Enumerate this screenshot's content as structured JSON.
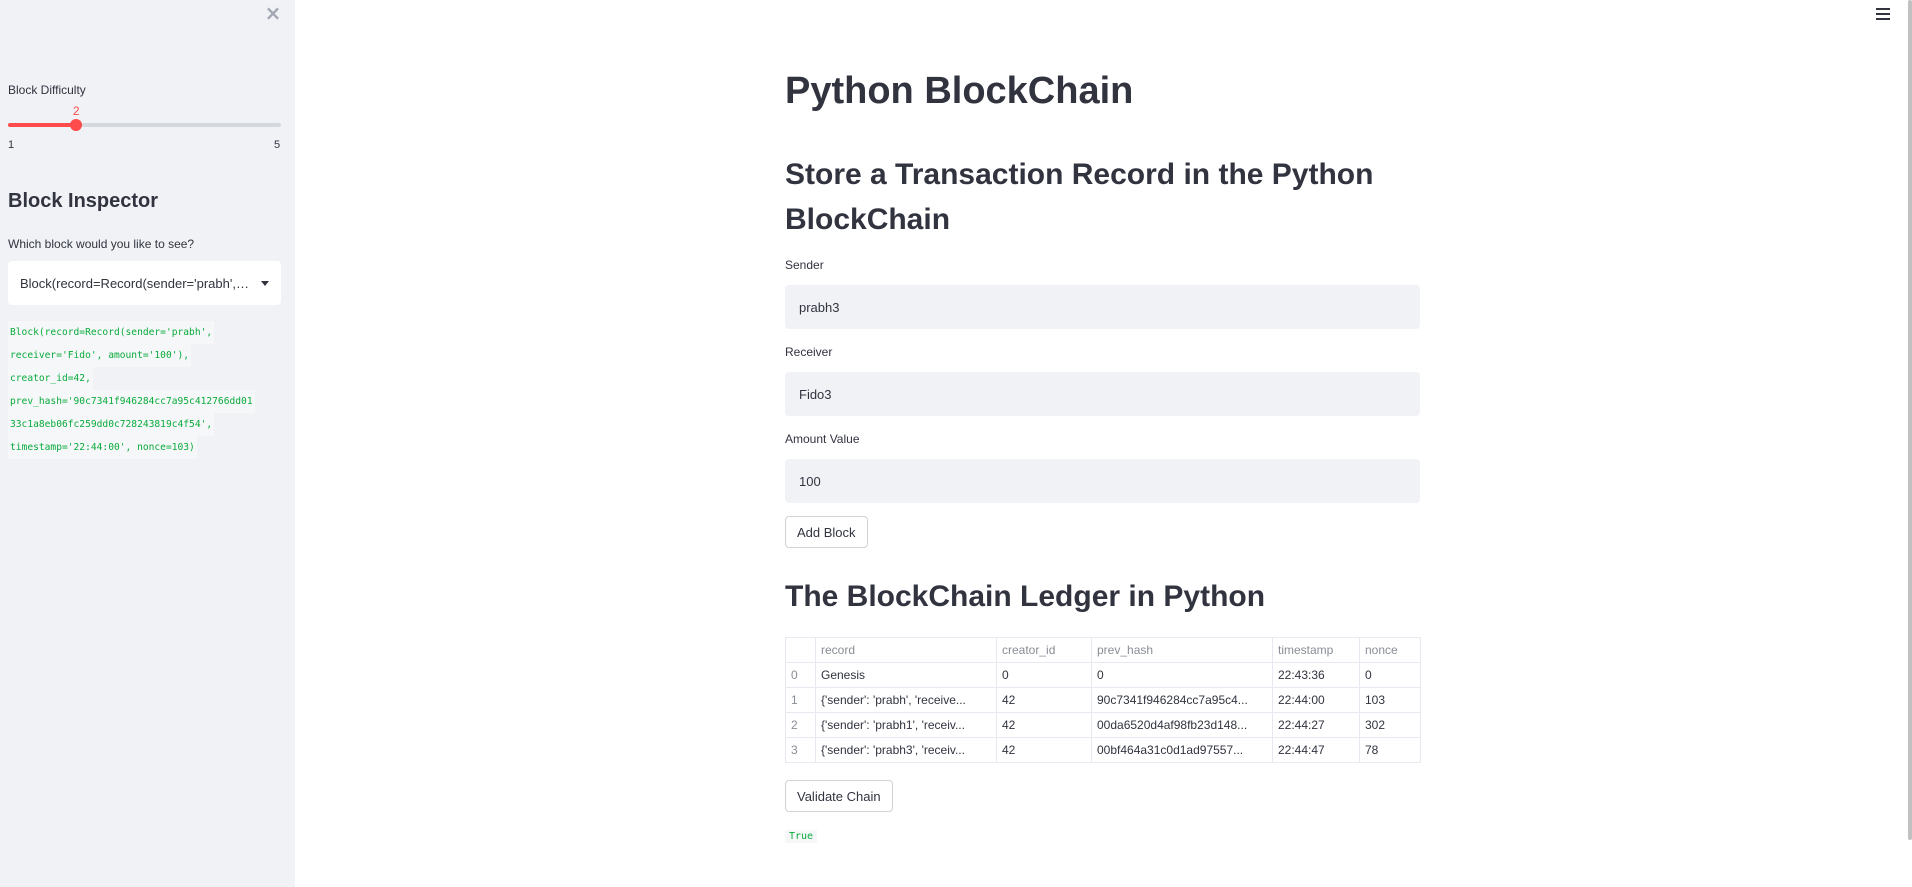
{
  "sidebar": {
    "close_glyph": "×",
    "difficulty": {
      "label": "Block Difficulty",
      "value": 2,
      "min": 1,
      "max": 5,
      "min_label": "1",
      "max_label": "5",
      "value_label": "2"
    },
    "inspector": {
      "heading": "Block Inspector",
      "question": "Which block would you like to see?",
      "selected": "Block(record=Record(sender='prabh', receiver='Fido', amount='100'), creator_id=42, prev_hash='90c7341f946284cc7a95c412766dd0133c1a8eb06fc259dd0c728243819c4f54', timestamp='22:44:00', nonce=103)",
      "code_lines": [
        "Block(record=Record(sender='prabh',",
        "receiver='Fido', amount='100'),",
        "creator_id=42,",
        "prev_hash='90c7341f946284cc7a95c412766dd01",
        "33c1a8eb06fc259dd0c728243819c4f54',",
        "timestamp='22:44:00', nonce=103)"
      ]
    }
  },
  "main": {
    "title": "Python BlockChain",
    "subtitle": "Store a Transaction Record in the Python BlockChain",
    "form": {
      "sender_label": "Sender",
      "sender_value": "prabh3",
      "receiver_label": "Receiver",
      "receiver_value": "Fido3",
      "amount_label": "Amount Value",
      "amount_value": "100",
      "add_button": "Add Block"
    },
    "ledger": {
      "heading": "The BlockChain Ledger in Python",
      "columns": [
        "",
        "record",
        "creator_id",
        "prev_hash",
        "timestamp",
        "nonce"
      ],
      "rows": [
        [
          "0",
          "Genesis",
          "0",
          "0",
          "22:43:36",
          "0"
        ],
        [
          "1",
          "{'sender': 'prabh', 'receive...",
          "42",
          "90c7341f946284cc7a95c4...",
          "22:44:00",
          "103"
        ],
        [
          "2",
          "{'sender': 'prabh1', 'receiv...",
          "42",
          "00da6520d4af98fb23d148...",
          "22:44:27",
          "302"
        ],
        [
          "3",
          "{'sender': 'prabh3', 'receiv...",
          "42",
          "00bf464a31c0d1ad97557...",
          "22:44:47",
          "78"
        ]
      ]
    },
    "validate_button": "Validate Chain",
    "validate_result": "True"
  },
  "colors": {
    "accent": "#ff4b4b",
    "sidebar_bg": "#f0f2f6",
    "code_green": "#09ab3b",
    "text": "#31333f"
  }
}
